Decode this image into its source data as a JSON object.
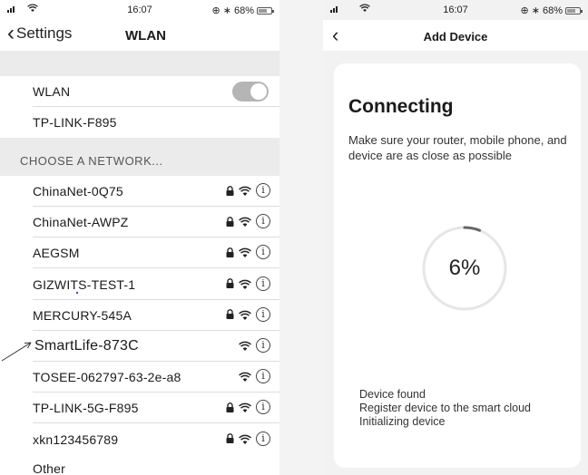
{
  "left_phone": {
    "status": {
      "time": "16:07",
      "battery": "68%",
      "battery_level": 0.68
    },
    "navbar": {
      "back_label": "Settings",
      "title": "WLAN"
    },
    "wlan_toggle": {
      "label": "WLAN",
      "on": false
    },
    "connected_network": "TP-LINK-F895",
    "section_header": "CHOOSE A NETWORK...",
    "networks": [
      {
        "name": "ChinaNet-0Q75",
        "locked": true
      },
      {
        "name": "ChinaNet-AWPZ",
        "locked": true
      },
      {
        "name": "AEGSM",
        "locked": true
      },
      {
        "name": "GIZWITS-TEST-1",
        "locked": true
      },
      {
        "name": "MERCURY-545A",
        "locked": true
      },
      {
        "name": "SmartLife-873C",
        "locked": false
      },
      {
        "name": "TOSEE-062797-63-2e-a8",
        "locked": false
      },
      {
        "name": "TP-LINK-5G-F895",
        "locked": true
      },
      {
        "name": "xkn123456789",
        "locked": true
      }
    ],
    "other_label": "Other"
  },
  "right_phone": {
    "status": {
      "time": "16:07",
      "battery": "68%",
      "battery_level": 0.68
    },
    "navbar": {
      "title": "Add Device"
    },
    "card": {
      "title": "Connecting",
      "description": "Make sure your router, mobile phone, and device are as close as possible",
      "progress_percent": 6,
      "progress_label": "6%",
      "steps": [
        "Device found",
        "Register device to the smart cloud",
        "Initializing device"
      ]
    }
  },
  "colors": {
    "toggle_off": "#b5b5b5",
    "section_bg": "#ebebeb",
    "progress_track": "#e6e6e6",
    "progress_arc": "#666666"
  },
  "icons": {
    "lock": "lock-icon",
    "wifi": "wifi-icon",
    "info": "info-icon",
    "back": "chevron-left-icon"
  }
}
